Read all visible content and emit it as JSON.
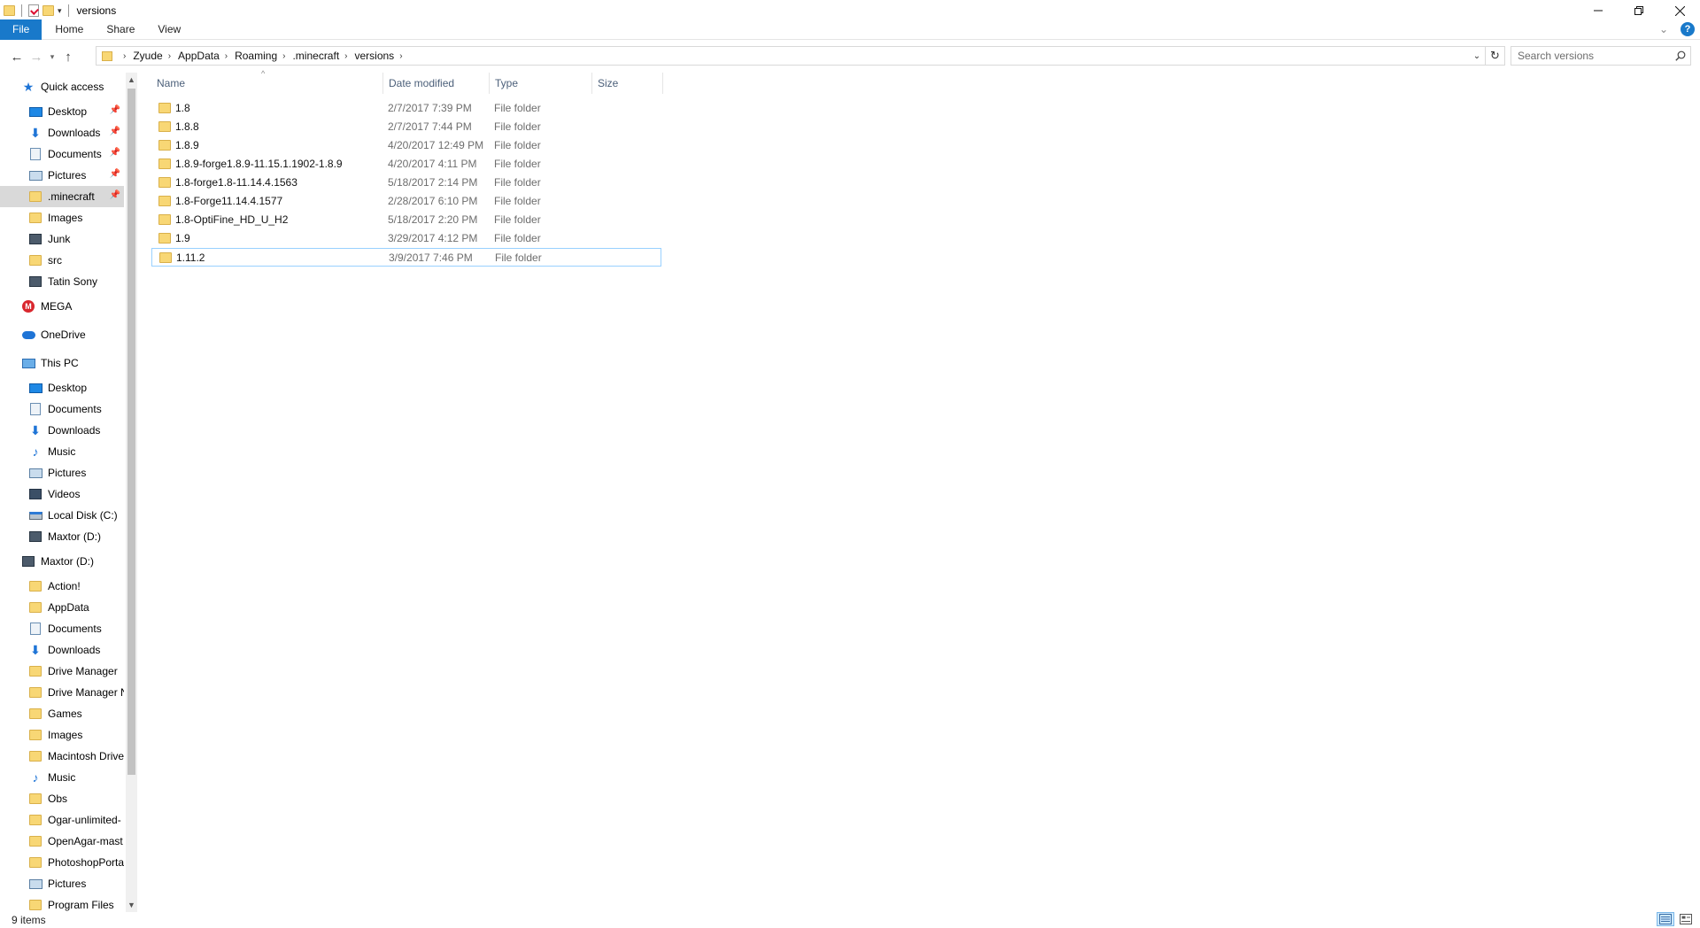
{
  "window": {
    "title": "versions"
  },
  "ribbon": {
    "tabs": [
      "File",
      "Home",
      "Share",
      "View"
    ]
  },
  "address": {
    "crumbs": [
      "Zyude",
      "AppData",
      "Roaming",
      ".minecraft",
      "versions"
    ]
  },
  "search": {
    "placeholder": "Search versions"
  },
  "columns": {
    "name": "Name",
    "date": "Date modified",
    "type": "Type",
    "size": "Size"
  },
  "files": [
    {
      "name": "1.8",
      "date": "2/7/2017 7:39 PM",
      "type": "File folder"
    },
    {
      "name": "1.8.8",
      "date": "2/7/2017 7:44 PM",
      "type": "File folder"
    },
    {
      "name": "1.8.9",
      "date": "4/20/2017 12:49 PM",
      "type": "File folder"
    },
    {
      "name": "1.8.9-forge1.8.9-11.15.1.1902-1.8.9",
      "date": "4/20/2017 4:11 PM",
      "type": "File folder"
    },
    {
      "name": "1.8-forge1.8-11.14.4.1563",
      "date": "5/18/2017 2:14 PM",
      "type": "File folder"
    },
    {
      "name": "1.8-Forge11.14.4.1577",
      "date": "2/28/2017 6:10 PM",
      "type": "File folder"
    },
    {
      "name": "1.8-OptiFine_HD_U_H2",
      "date": "5/18/2017 2:20 PM",
      "type": "File folder"
    },
    {
      "name": "1.9",
      "date": "3/29/2017 4:12 PM",
      "type": "File folder"
    },
    {
      "name": "1.11.2",
      "date": "3/9/2017 7:46 PM",
      "type": "File folder"
    }
  ],
  "nav": {
    "quick_access": "Quick access",
    "quick_items": [
      "Desktop",
      "Downloads",
      "Documents",
      "Pictures",
      ".minecraft",
      "Images",
      "Junk",
      "src",
      "Tatin Sony"
    ],
    "mega": "MEGA",
    "onedrive": "OneDrive",
    "this_pc": "This PC",
    "pc_items": [
      "Desktop",
      "Documents",
      "Downloads",
      "Music",
      "Pictures",
      "Videos",
      "Local Disk (C:)",
      "Maxtor (D:)"
    ],
    "drive": "Maxtor (D:)",
    "drive_items": [
      "Action!",
      "AppData",
      "Documents",
      "Downloads",
      "Drive Manager",
      "Drive Manager N",
      "Games",
      "Images",
      "Macintosh Drive",
      "Music",
      "Obs",
      "Ogar-unlimited-",
      "OpenAgar-mast",
      "PhotoshopPorta",
      "Pictures",
      "Program Files"
    ]
  },
  "status": {
    "items": "9 items"
  },
  "colors": {
    "accent": "#1979ca",
    "selection_border": "#99d1ff",
    "nav_selected": "#d9d9d9"
  }
}
